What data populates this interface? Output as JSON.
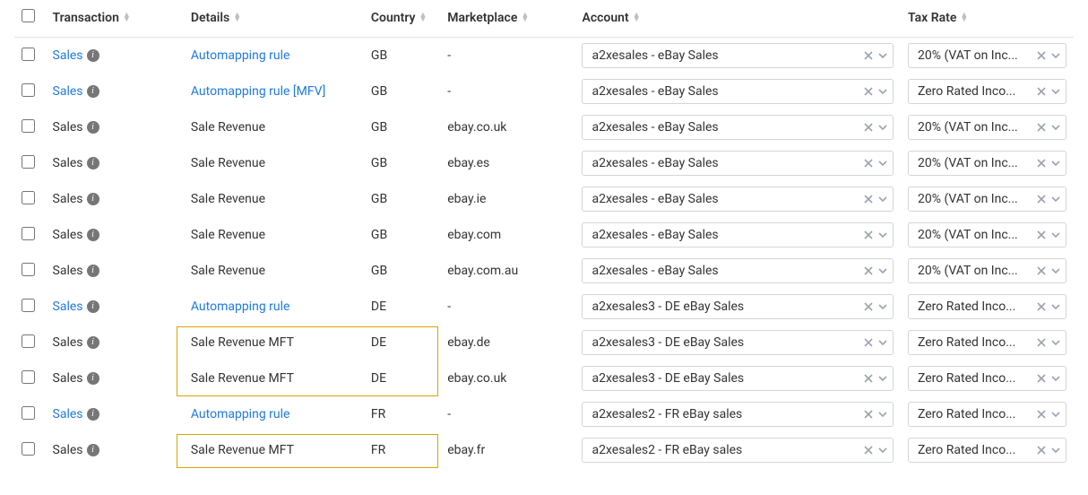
{
  "columns": {
    "transaction": "Transaction",
    "details": "Details",
    "country": "Country",
    "marketplace": "Marketplace",
    "account": "Account",
    "tax": "Tax Rate"
  },
  "rows": [
    {
      "transaction": "Sales",
      "tLink": true,
      "details": "Automapping rule",
      "dLink": true,
      "country": "GB",
      "market": "-",
      "account": "a2xesales - eBay Sales",
      "tax": "20% (VAT on Inc...",
      "hl": false
    },
    {
      "transaction": "Sales",
      "tLink": true,
      "details": "Automapping rule [MFV]",
      "dLink": true,
      "country": "GB",
      "market": "-",
      "account": "a2xesales - eBay Sales",
      "tax": "Zero Rated Inco...",
      "hl": false
    },
    {
      "transaction": "Sales",
      "tLink": false,
      "details": "Sale Revenue",
      "dLink": false,
      "country": "GB",
      "market": "ebay.co.uk",
      "account": "a2xesales - eBay Sales",
      "tax": "20% (VAT on Inc...",
      "hl": false
    },
    {
      "transaction": "Sales",
      "tLink": false,
      "details": "Sale Revenue",
      "dLink": false,
      "country": "GB",
      "market": "ebay.es",
      "account": "a2xesales - eBay Sales",
      "tax": "20% (VAT on Inc...",
      "hl": false
    },
    {
      "transaction": "Sales",
      "tLink": false,
      "details": "Sale Revenue",
      "dLink": false,
      "country": "GB",
      "market": "ebay.ie",
      "account": "a2xesales - eBay Sales",
      "tax": "20% (VAT on Inc...",
      "hl": false
    },
    {
      "transaction": "Sales",
      "tLink": false,
      "details": "Sale Revenue",
      "dLink": false,
      "country": "GB",
      "market": "ebay.com",
      "account": "a2xesales - eBay Sales",
      "tax": "20% (VAT on Inc...",
      "hl": false
    },
    {
      "transaction": "Sales",
      "tLink": false,
      "details": "Sale Revenue",
      "dLink": false,
      "country": "GB",
      "market": "ebay.com.au",
      "account": "a2xesales - eBay Sales",
      "tax": "20% (VAT on Inc...",
      "hl": false
    },
    {
      "transaction": "Sales",
      "tLink": true,
      "details": "Automapping rule",
      "dLink": true,
      "country": "DE",
      "market": "-",
      "account": "a2xesales3 - DE eBay Sales",
      "tax": "Zero Rated Inco...",
      "hl": false
    },
    {
      "transaction": "Sales",
      "tLink": false,
      "details": "Sale Revenue MFT",
      "dLink": false,
      "country": "DE",
      "market": "ebay.de",
      "account": "a2xesales3 - DE eBay Sales",
      "tax": "Zero Rated Inco...",
      "hl": true
    },
    {
      "transaction": "Sales",
      "tLink": false,
      "details": "Sale Revenue MFT",
      "dLink": false,
      "country": "DE",
      "market": "ebay.co.uk",
      "account": "a2xesales3 - DE eBay Sales",
      "tax": "Zero Rated Inco...",
      "hl": true
    },
    {
      "transaction": "Sales",
      "tLink": true,
      "details": "Automapping rule",
      "dLink": true,
      "country": "FR",
      "market": "-",
      "account": "a2xesales2 - FR eBay sales",
      "tax": "Zero Rated Inco...",
      "hl": false
    },
    {
      "transaction": "Sales",
      "tLink": false,
      "details": "Sale Revenue MFT",
      "dLink": false,
      "country": "FR",
      "market": "ebay.fr",
      "account": "a2xesales2 - FR eBay sales",
      "tax": "Zero Rated Inco...",
      "hl": true
    }
  ]
}
